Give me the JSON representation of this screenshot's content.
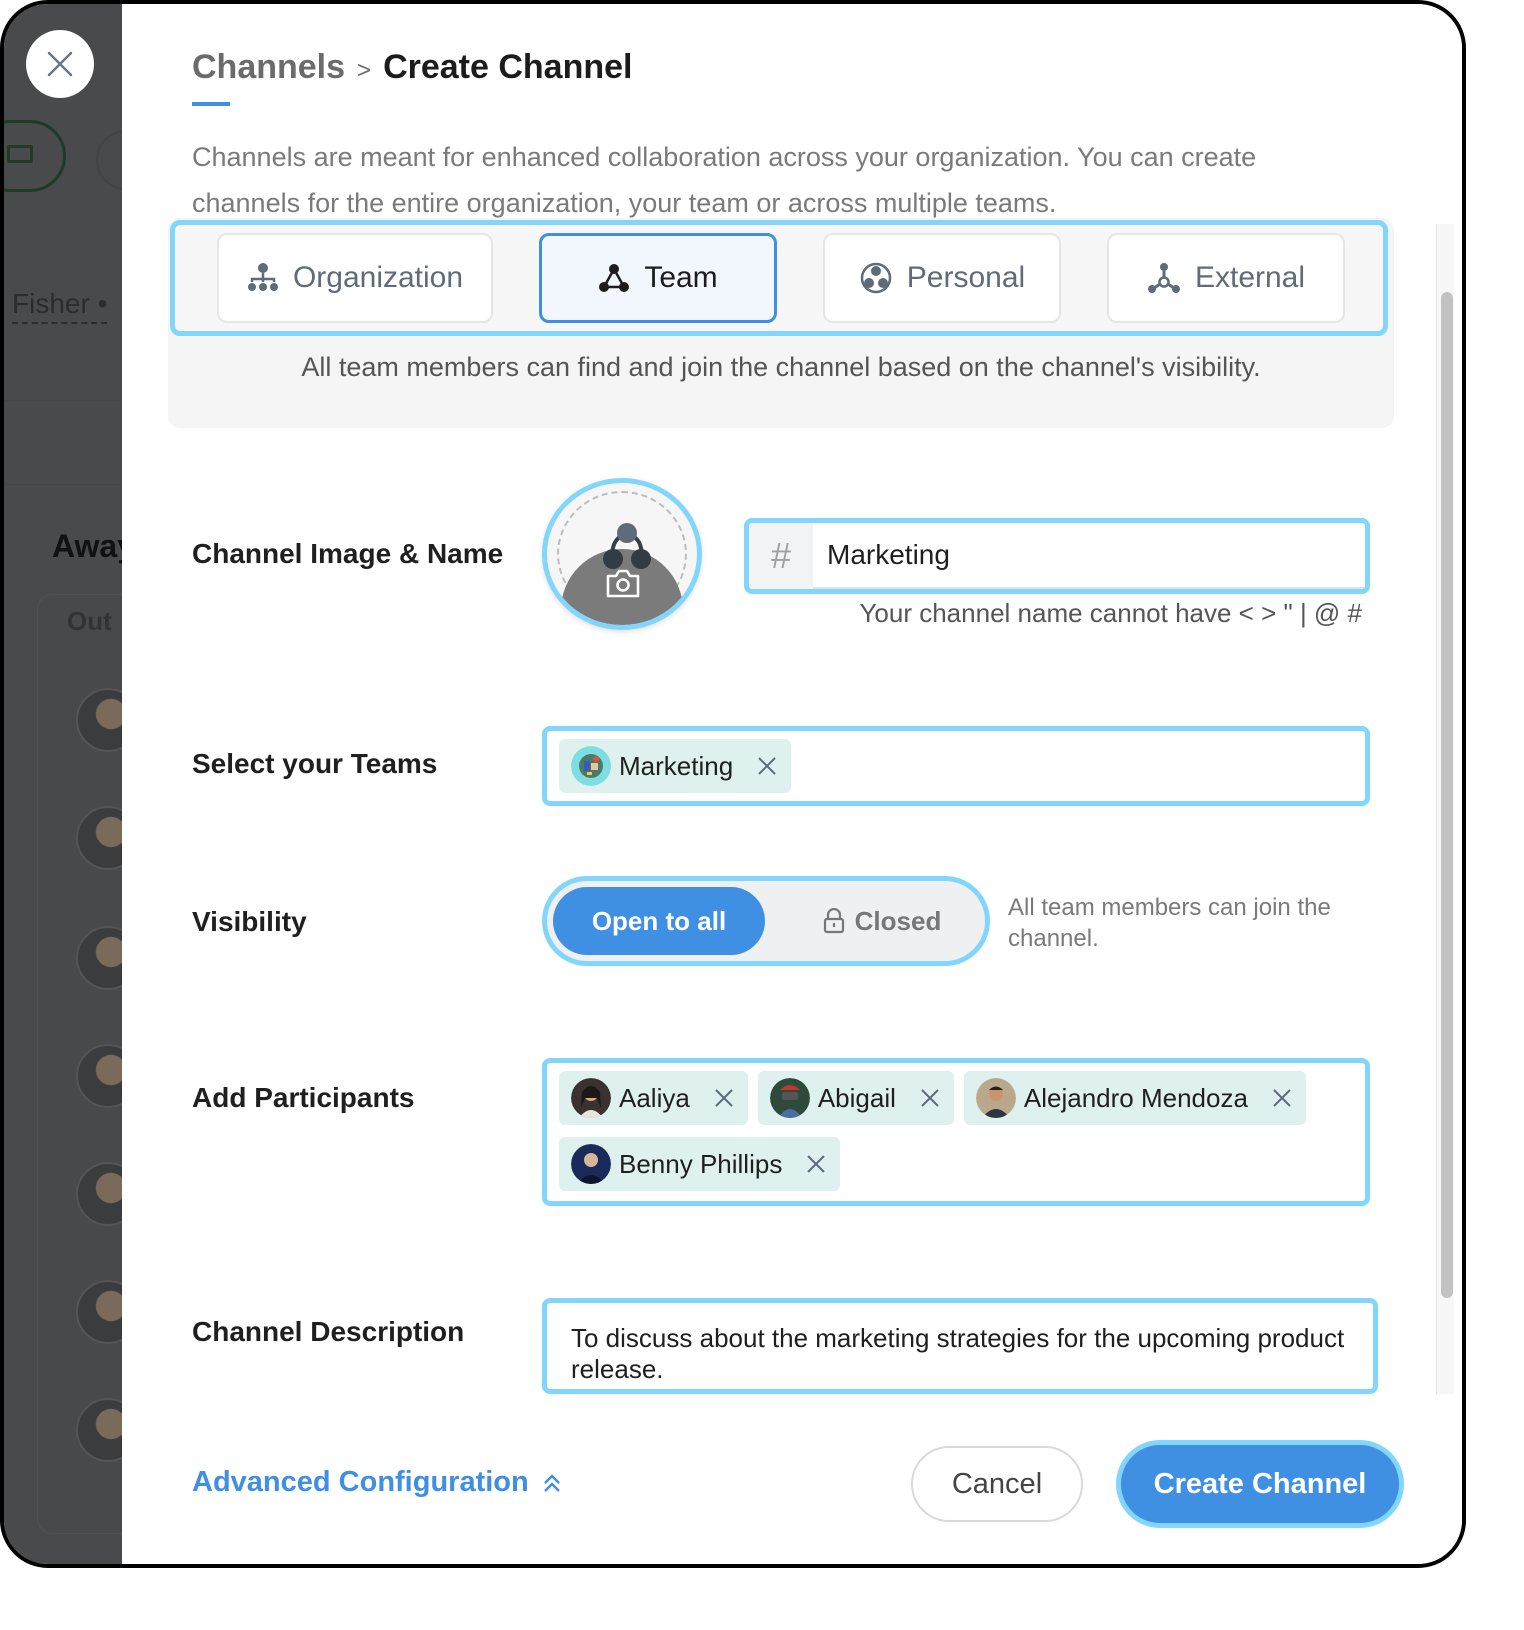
{
  "background_app": {
    "partial_name": "Fisher •",
    "section_title": "Away",
    "card_label": "Out"
  },
  "breadcrumb": {
    "parent": "Channels",
    "separator": ">",
    "current": "Create Channel"
  },
  "intro_text": "Channels are meant for enhanced collaboration across your organization. You can create channels for the entire organization, your team or across multiple teams.",
  "channel_types": {
    "selected": "Team",
    "options": [
      {
        "label": "Organization",
        "icon": "org-chart-icon"
      },
      {
        "label": "Team",
        "icon": "team-icon"
      },
      {
        "label": "Personal",
        "icon": "personal-icon"
      },
      {
        "label": "External",
        "icon": "external-icon"
      }
    ],
    "description": "All team members can find and join the channel based on the channel's visibility."
  },
  "form": {
    "image_name": {
      "label": "Channel Image & Name",
      "prefix": "#",
      "value": "Marketing",
      "hint": "Your channel name cannot have < > \" | @ #"
    },
    "teams": {
      "label": "Select your Teams",
      "selected": [
        {
          "name": "Marketing"
        }
      ]
    },
    "visibility": {
      "label": "Visibility",
      "options": [
        "Open to all",
        "Closed"
      ],
      "selected": "Open to all",
      "hint": "All team members can join the channel."
    },
    "participants": {
      "label": "Add Participants",
      "selected": [
        {
          "name": "Aaliya"
        },
        {
          "name": "Abigail"
        },
        {
          "name": "Alejandro Mendoza"
        },
        {
          "name": "Benny Phillips"
        }
      ]
    },
    "description": {
      "label": "Channel Description",
      "value": "To discuss about the marketing strategies for the upcoming product release."
    }
  },
  "footer": {
    "advanced_label": "Advanced Configuration",
    "cancel_label": "Cancel",
    "create_label": "Create Channel"
  },
  "colors": {
    "accent": "#3f8fe3",
    "focus_ring": "#82d6fb",
    "tag_bg": "#dff1ef"
  }
}
